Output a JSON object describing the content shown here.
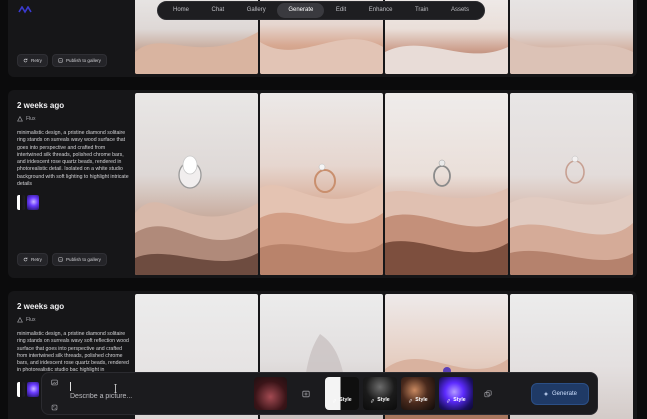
{
  "nav": {
    "tabs": [
      {
        "label": "Home"
      },
      {
        "label": "Chat"
      },
      {
        "label": "Gallery"
      },
      {
        "label": "Generate",
        "active": true
      },
      {
        "label": "Edit"
      },
      {
        "label": "Enhance"
      },
      {
        "label": "Train"
      },
      {
        "label": "Assets"
      }
    ]
  },
  "rows": [
    {
      "retry_label": "Retry",
      "publish_label": "Publish to gallery"
    },
    {
      "date": "2 weeks ago",
      "model": "Flux",
      "prompt": "minimalistic design, a pristine diamond solitaire ring stands on surreals wavy wood surface that goes into perspective and crafted from intertwined silk threads, polished chrome bars, and iridescent rose quartz beads, rendered in photorealistic detail. Isolated on a white studio background with soft lighting to highlight intricate details",
      "retry_label": "Retry",
      "publish_label": "Publish to gallery"
    },
    {
      "date": "2 weeks ago",
      "model": "Flux",
      "prompt": "minimalistic design, a pristine diamond solitaire ring stands on surreals wavy soft reflection wood surface that goes into perspective and crafted from intertwined silk threads, polished chrome bars, and iridescent rose quartz beads, rendered in photorealistic studio bac highlight in"
    }
  ],
  "composer": {
    "placeholder": "Describe a picture...",
    "style_label": "Style",
    "generate_label": "Generate"
  },
  "colors": {
    "background": "#0b0b0c",
    "card": "#161618",
    "accent": "#1f3a66"
  }
}
